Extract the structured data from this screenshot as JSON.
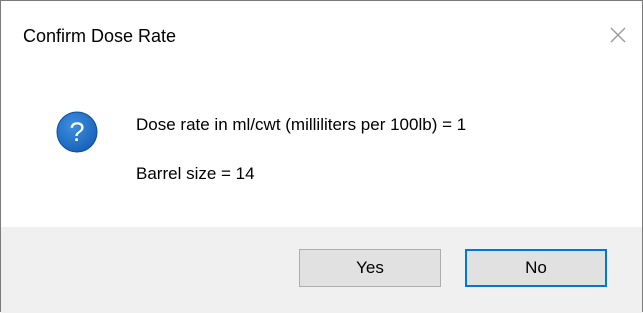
{
  "dialog": {
    "title": "Confirm Dose Rate",
    "message_line1": "Dose rate in ml/cwt (milliliters per 100lb) = 1",
    "message_line2": "Barrel size = 14",
    "icon": "question-icon",
    "close_icon": "close-icon"
  },
  "buttons": {
    "yes_label": "Yes",
    "no_label": "No"
  },
  "colors": {
    "icon_blue": "#1e6fc8",
    "focus_border": "#0078d7",
    "footer_bg": "#f0f0f0",
    "button_bg": "#e1e1e1"
  }
}
